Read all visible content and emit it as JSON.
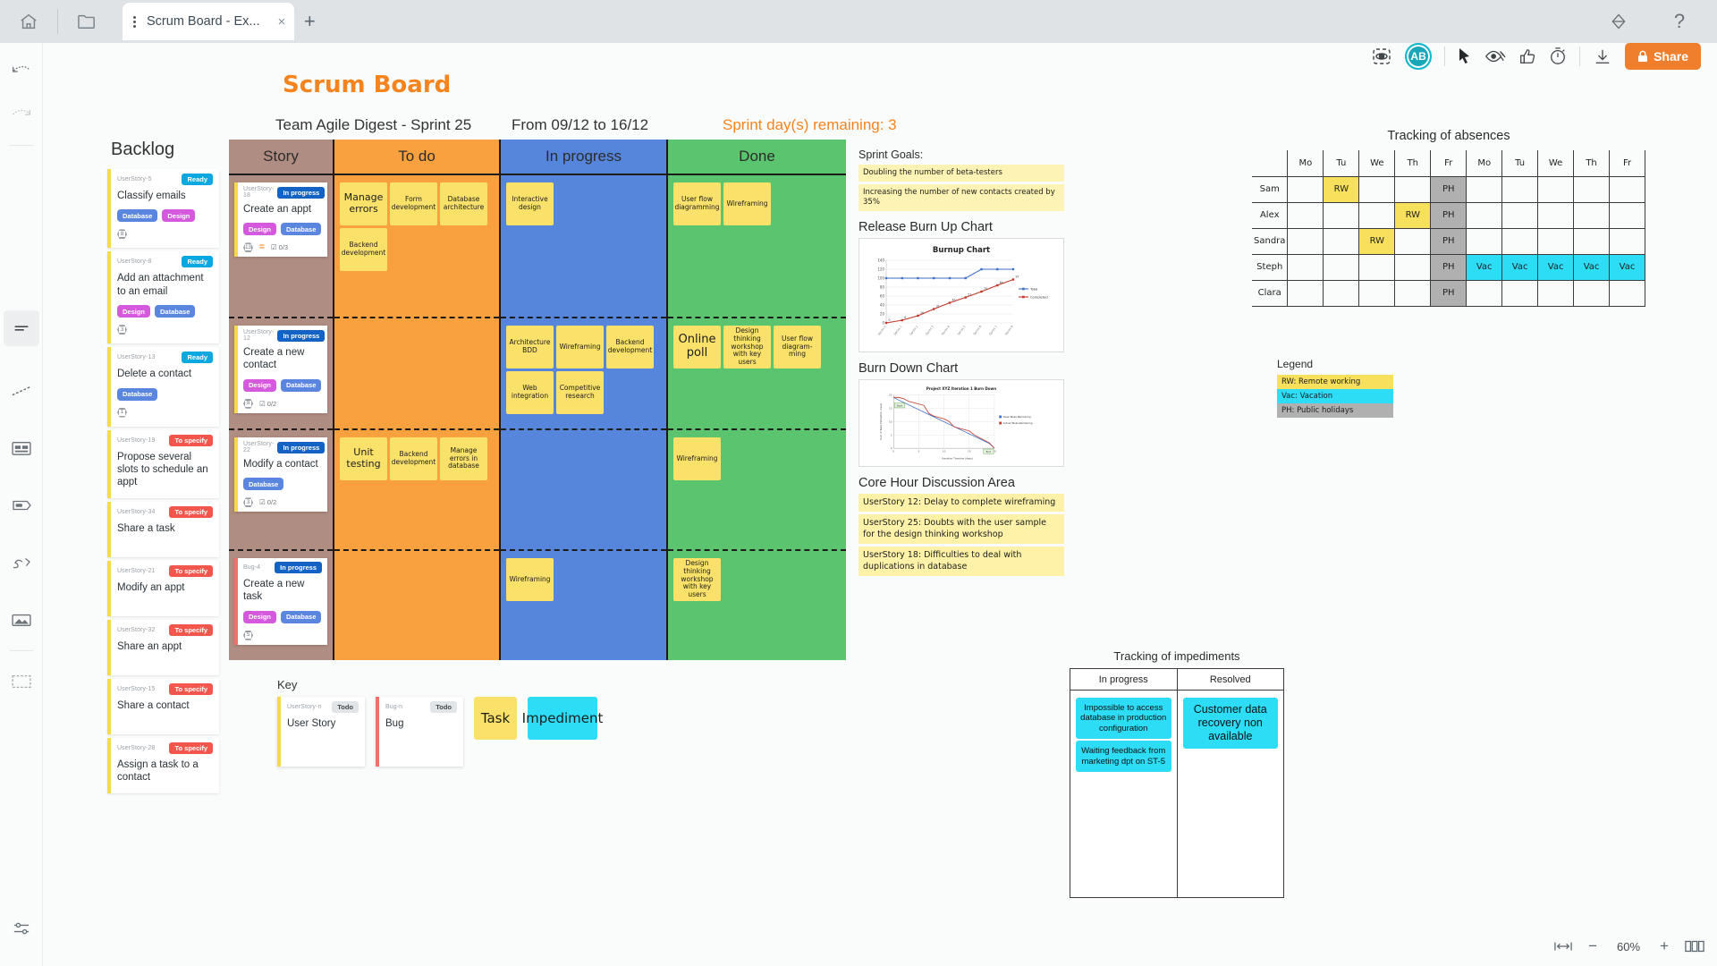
{
  "browser": {
    "home_icon": "home-icon",
    "folder_icon": "folder-icon",
    "tab_title": "Scrum Board - Ex...",
    "tab_close": "×",
    "new_tab": "+",
    "help": "?",
    "plugin_icon": "diamond-icon"
  },
  "toolbar": {
    "present_icon": "presentation-icon",
    "avatar_initials": "AB",
    "cursor_icon": "cursor-icon",
    "hide_icon": "eye-hide-icon",
    "like_icon": "thumbs-up-icon",
    "timer_icon": "timer-icon",
    "download_icon": "download-icon",
    "share_label": "Share",
    "share_lock_icon": "lock-icon",
    "share_color": "#f07f2d"
  },
  "rail": {
    "items": [
      "undo-icon",
      "redo-icon",
      "sticky-note-icon",
      "line-icon",
      "card-icon",
      "tag-icon",
      "pen-icon",
      "image-icon",
      "frame-icon",
      "settings-icon"
    ]
  },
  "header": {
    "title": "Scrum Board",
    "team": "Team Agile Digest - Sprint 25",
    "dates": "From 09/12 to 16/12",
    "remaining": "Sprint day(s) remaining: 3",
    "accent": "#f5841f"
  },
  "backlog": {
    "heading": "Backlog",
    "cards": [
      {
        "id": "UserStory-5",
        "status": "Ready",
        "status_kind": "ready",
        "title": "Classify emails",
        "tags": [
          "Database",
          "Design"
        ],
        "points": "8"
      },
      {
        "id": "UserStory-8",
        "status": "Ready",
        "status_kind": "ready",
        "title": "Add an attachment to an email",
        "tags": [
          "Design",
          "Database"
        ],
        "points": "3"
      },
      {
        "id": "UserStory-13",
        "status": "Ready",
        "status_kind": "ready",
        "title": "Delete a contact",
        "tags": [
          "Database"
        ],
        "points": "1"
      },
      {
        "id": "UserStory-19",
        "status": "To specify",
        "status_kind": "tospec",
        "title": "Propose several slots to schedule an appt",
        "tags": [],
        "points": ""
      },
      {
        "id": "UserStory-34",
        "status": "To specify",
        "status_kind": "tospec",
        "title": "Share a task",
        "tags": [],
        "points": ""
      },
      {
        "id": "UserStory-21",
        "status": "To specify",
        "status_kind": "tospec",
        "title": "Modify an appt",
        "tags": [],
        "points": ""
      },
      {
        "id": "UserStory-32",
        "status": "To specify",
        "status_kind": "tospec",
        "title": "Share an appt",
        "tags": [],
        "points": ""
      },
      {
        "id": "UserStory-15",
        "status": "To specify",
        "status_kind": "tospec",
        "title": "Share a contact",
        "tags": [],
        "points": ""
      },
      {
        "id": "UserStory-28",
        "status": "To specify",
        "status_kind": "tospec",
        "title": "Assign a task to a contact",
        "tags": [],
        "points": ""
      }
    ]
  },
  "board": {
    "columns": [
      {
        "label": "Story",
        "color": "#b08d82"
      },
      {
        "label": "To do",
        "color": "#f9a13e"
      },
      {
        "label": "In progress",
        "color": "#5686dc"
      },
      {
        "label": "Done",
        "color": "#5bc46f"
      }
    ],
    "rows": [
      {
        "story": {
          "id": "UserStory-18",
          "status": "In progress",
          "title": "Create an appt",
          "tags": [
            "Design",
            "Database"
          ],
          "points": "13",
          "priority": "=",
          "checklist": "0/3",
          "kind": "story"
        },
        "todo": [
          "Manage errors",
          "Form development",
          "Database architecture",
          "Backend development"
        ],
        "in_progress": [
          "Interactive design"
        ],
        "done": [
          "User flow diagramming",
          "Wireframing"
        ]
      },
      {
        "story": {
          "id": "UserStory-12",
          "status": "In progress",
          "title": "Create a new contact",
          "tags": [
            "Design",
            "Database"
          ],
          "points": "8",
          "priority": "",
          "checklist": "0/2",
          "kind": "story"
        },
        "todo": [],
        "in_progress": [
          "Architecture BDD",
          "Wireframing",
          "Backend development",
          "Web integration",
          "Competitive research"
        ],
        "done": [
          "Online poll",
          "Design thinking workshop with key users",
          "User flow diagram-ming"
        ]
      },
      {
        "story": {
          "id": "UserStory-22",
          "status": "In progress",
          "title": "Modify a contact",
          "tags": [
            "Database"
          ],
          "points": "3",
          "priority": "",
          "checklist": "0/2",
          "kind": "story"
        },
        "todo": [
          "Unit testing",
          "Backend development",
          "Manage errors in database"
        ],
        "in_progress": [],
        "done": [
          "Wireframing"
        ]
      },
      {
        "story": {
          "id": "Bug-4",
          "status": "In progress",
          "title": "Create a new task",
          "tags": [
            "Design",
            "Database"
          ],
          "points": "5",
          "priority": "",
          "checklist": "",
          "kind": "bug"
        },
        "todo": [],
        "in_progress": [
          "Wireframing"
        ],
        "done": [
          "Design thinking workshop with key users"
        ]
      }
    ]
  },
  "key": {
    "heading": "Key",
    "user_story": {
      "id": "UserStory-n",
      "status": "Todo",
      "label": "User Story"
    },
    "bug": {
      "id": "Bug-n",
      "status": "Todo",
      "label": "Bug"
    },
    "task_label": "Task",
    "impediment_label": "Impediment",
    "task_color": "#f9e16a",
    "impediment_color": "#2ddcf5"
  },
  "sprint_goals": {
    "heading": "Sprint Goals:",
    "items": [
      "Doubling the number of beta-testers",
      "Increasing the number of new contacts created by 35%"
    ]
  },
  "burn_up": {
    "heading": "Release Burn Up Chart"
  },
  "burn_down": {
    "heading": "Burn Down Chart"
  },
  "core_hour": {
    "heading": "Core Hour Discussion Area",
    "items": [
      "UserStory 12: Delay to complete wireframing",
      "UserStory 25: Doubts with the user sample for the design thinking workshop",
      "UserStory 18: Difficulties to deal with duplications in database"
    ]
  },
  "absences": {
    "title": "Tracking of absences",
    "days": [
      "Mo",
      "Tu",
      "We",
      "Th",
      "Fr",
      "Mo",
      "Tu",
      "We",
      "Th",
      "Fr"
    ],
    "rows": [
      {
        "name": "Sam",
        "cells": [
          "",
          "RW",
          "",
          "",
          "PH",
          "",
          "",
          "",
          "",
          ""
        ]
      },
      {
        "name": "Alex",
        "cells": [
          "",
          "",
          "",
          "RW",
          "PH",
          "",
          "",
          "",
          "",
          ""
        ]
      },
      {
        "name": "Sandra",
        "cells": [
          "",
          "",
          "RW",
          "",
          "PH",
          "",
          "",
          "",
          "",
          ""
        ]
      },
      {
        "name": "Steph",
        "cells": [
          "",
          "",
          "",
          "",
          "PH",
          "Vac",
          "Vac",
          "Vac",
          "Vac",
          "Vac"
        ]
      },
      {
        "name": "Clara",
        "cells": [
          "",
          "",
          "",
          "",
          "PH",
          "",
          "",
          "",
          "",
          ""
        ]
      }
    ]
  },
  "legend": {
    "heading": "Legend",
    "items": [
      {
        "text": "RW: Remote working",
        "color": "#f7e05c"
      },
      {
        "text": "Vac: Vacation",
        "color": "#2ddcf5"
      },
      {
        "text": "PH: Public holidays",
        "color": "#b0b0b0"
      }
    ]
  },
  "impediments": {
    "title": "Tracking of impediments",
    "columns": [
      "In progress",
      "Resolved"
    ],
    "in_progress": [
      "Impossible to access database in production configuration",
      "Waiting feedback from marketing dpt on ST-5"
    ],
    "resolved": [
      "Customer data recovery non available"
    ]
  },
  "zoom": {
    "fit_icon": "fit-screen-icon",
    "minus": "−",
    "value": "60%",
    "plus": "+",
    "pages_icon": "pages-icon"
  },
  "chart_data": [
    {
      "type": "line",
      "title": "Burnup Chart",
      "x": [
        "Sprint 0",
        "Sprint 1",
        "Sprint 2",
        "Sprint 3",
        "Sprint 4",
        "Sprint 5",
        "Sprint 6",
        "Sprint 7",
        "Sprint 8"
      ],
      "series": [
        {
          "name": "Total",
          "values": [
            100,
            100,
            100,
            100,
            100,
            100,
            120,
            120,
            120
          ],
          "color": "#3d6fc4"
        },
        {
          "name": "Completed",
          "values": [
            0,
            6,
            16,
            31,
            45,
            57,
            70,
            84,
            97
          ],
          "color": "#c0392b"
        }
      ],
      "ylim": [
        0,
        140
      ],
      "yticks": [
        0,
        20,
        40,
        60,
        80,
        100,
        120,
        140
      ],
      "legend": "right",
      "grid": true,
      "xlabel": "",
      "ylabel": ""
    },
    {
      "type": "line",
      "title": "Project XYZ Iteration 1 Burn Down",
      "x": [
        0,
        1,
        2,
        3,
        4,
        5,
        6,
        7,
        8,
        9,
        10,
        11,
        12,
        13,
        14,
        15,
        16,
        17,
        18,
        19,
        20
      ],
      "series": [
        {
          "name": "Ideal Tasks Remaining",
          "values": [
            19,
            18,
            17.1,
            16.2,
            15.3,
            14.4,
            13.5,
            12.6,
            11.7,
            10.8,
            9.9,
            9,
            8.1,
            7.2,
            6.3,
            5.4,
            4.5,
            3.6,
            2.7,
            1.8,
            0
          ],
          "color": "#3d6fc4"
        },
        {
          "name": "Actual Tasks Remaining",
          "values": [
            19,
            19,
            18.5,
            17.5,
            17,
            16.5,
            16,
            13,
            12,
            11.5,
            11,
            10,
            8,
            7.5,
            7,
            6.5,
            5,
            4,
            3,
            2,
            0
          ],
          "color": "#c0392b"
        }
      ],
      "ylim": [
        0,
        20
      ],
      "yticks": [
        0,
        5,
        10,
        15,
        20
      ],
      "xticks": [
        0,
        5,
        10,
        15,
        20
      ],
      "xlabel": "Iteration Timeline (days)",
      "ylabel": "Sum of Tasks Estimation (days)",
      "annotations": [
        "Start",
        "End"
      ],
      "legend": "right",
      "grid": true
    }
  ]
}
